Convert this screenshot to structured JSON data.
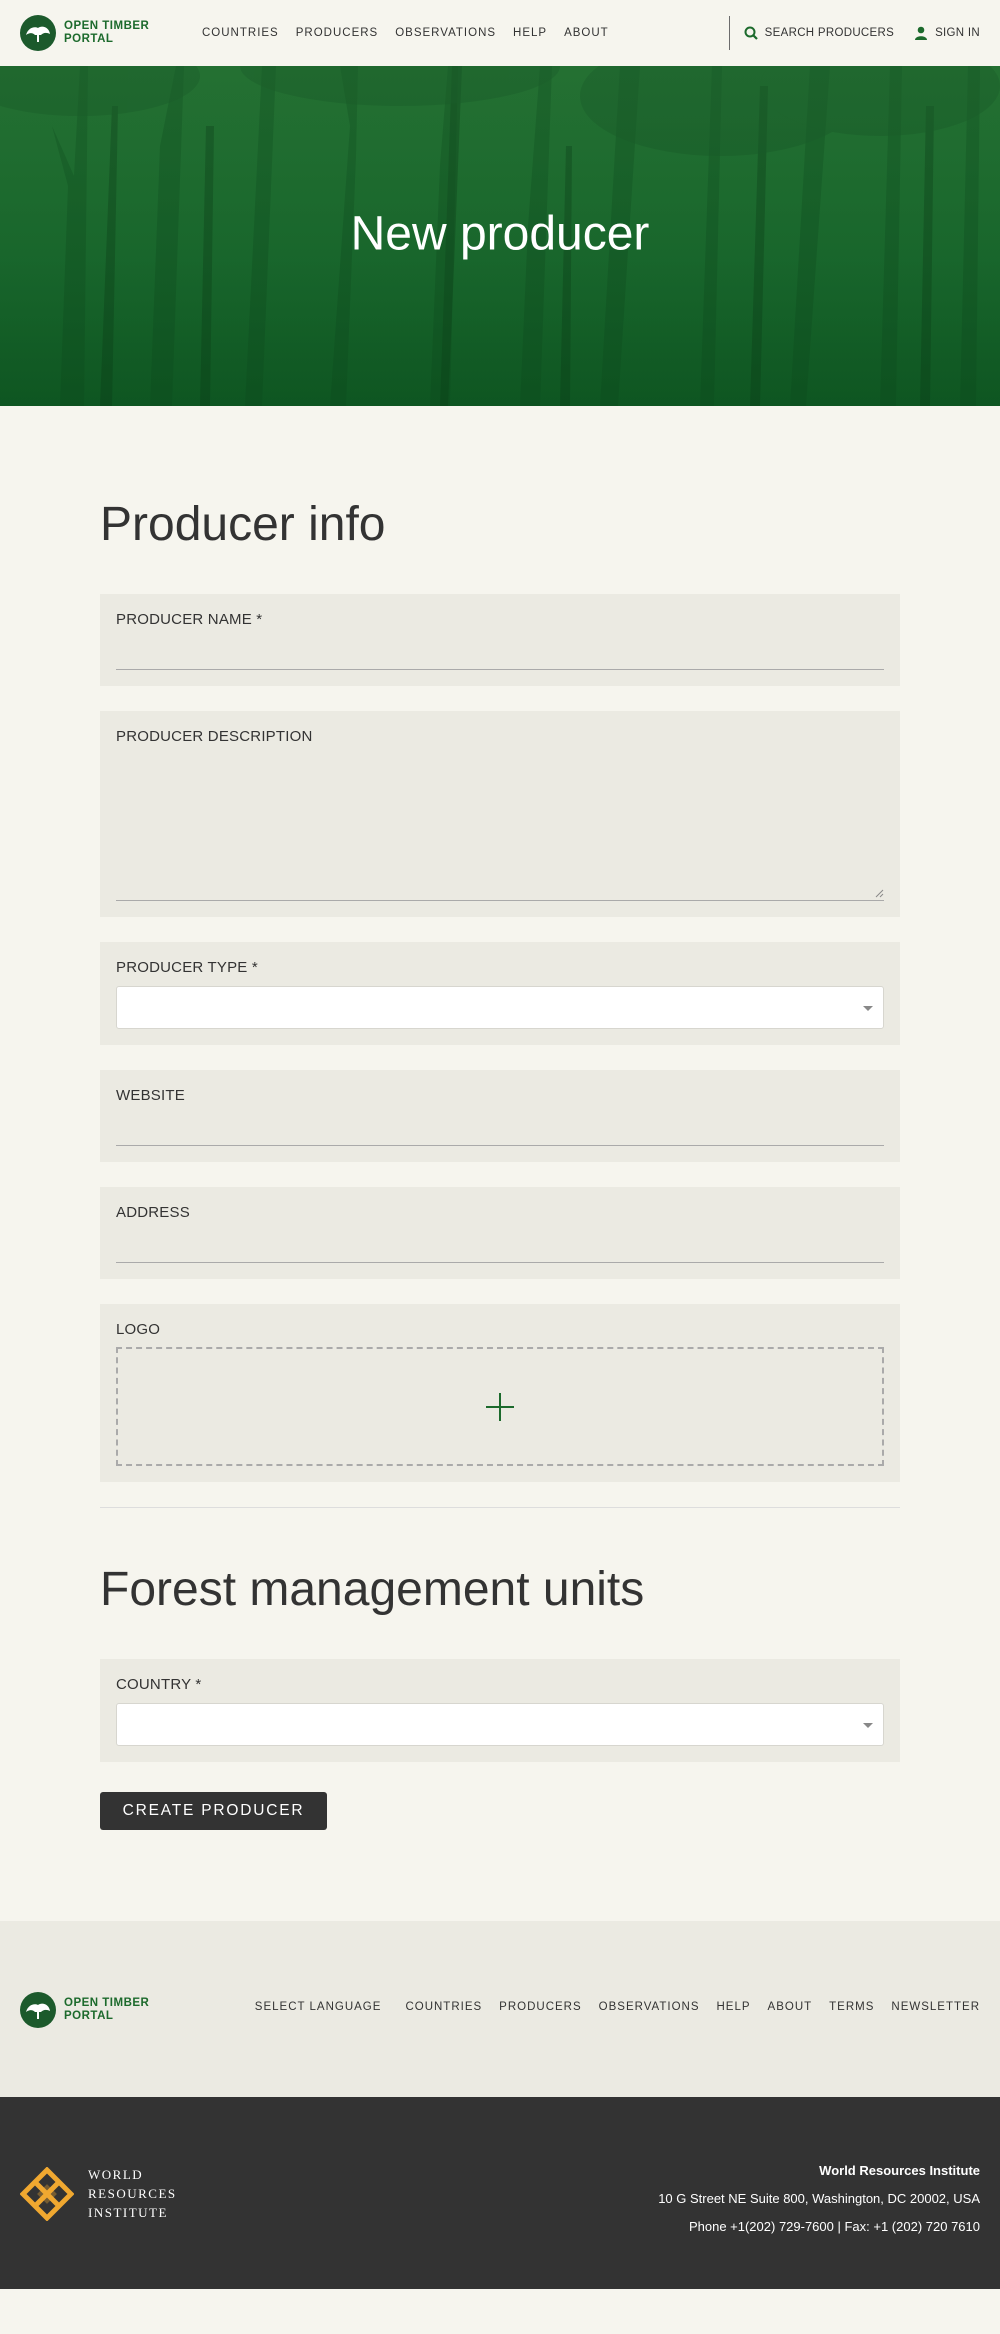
{
  "header": {
    "logo_line1": "OPEN TIMBER",
    "logo_line2": "PORTAL",
    "nav": [
      "COUNTRIES",
      "PRODUCERS",
      "OBSERVATIONS",
      "HELP",
      "ABOUT"
    ],
    "search_label": "SEARCH PRODUCERS",
    "signin_label": "SIGN IN"
  },
  "hero": {
    "title": "New producer"
  },
  "producer_info": {
    "title": "Producer info",
    "name_label": "PRODUCER NAME *",
    "description_label": "PRODUCER DESCRIPTION",
    "type_label": "PRODUCER TYPE *",
    "website_label": "WEBSITE",
    "address_label": "ADDRESS",
    "logo_label": "LOGO"
  },
  "fmu": {
    "title": "Forest management units",
    "country_label": "COUNTRY *"
  },
  "submit_label": "CREATE PRODUCER",
  "footer": {
    "logo_line1": "OPEN TIMBER",
    "logo_line2": "PORTAL",
    "select_language": "SELECT LANGUAGE",
    "nav": [
      "COUNTRIES",
      "PRODUCERS",
      "OBSERVATIONS",
      "HELP",
      "ABOUT",
      "TERMS",
      "NEWSLETTER"
    ],
    "wri_line1": "WORLD",
    "wri_line2": "RESOURCES",
    "wri_line3": "INSTITUTE",
    "org": "World Resources Institute",
    "address": "10 G Street NE Suite 800, Washington, DC 20002, USA",
    "phone": "Phone +1(202) 729-7600 | Fax: +1 (202) 720 7610"
  },
  "colors": {
    "brand_green": "#1c6a2c",
    "hero_green": "#17692c",
    "dark": "#333333",
    "wri_orange": "#f0a830"
  }
}
